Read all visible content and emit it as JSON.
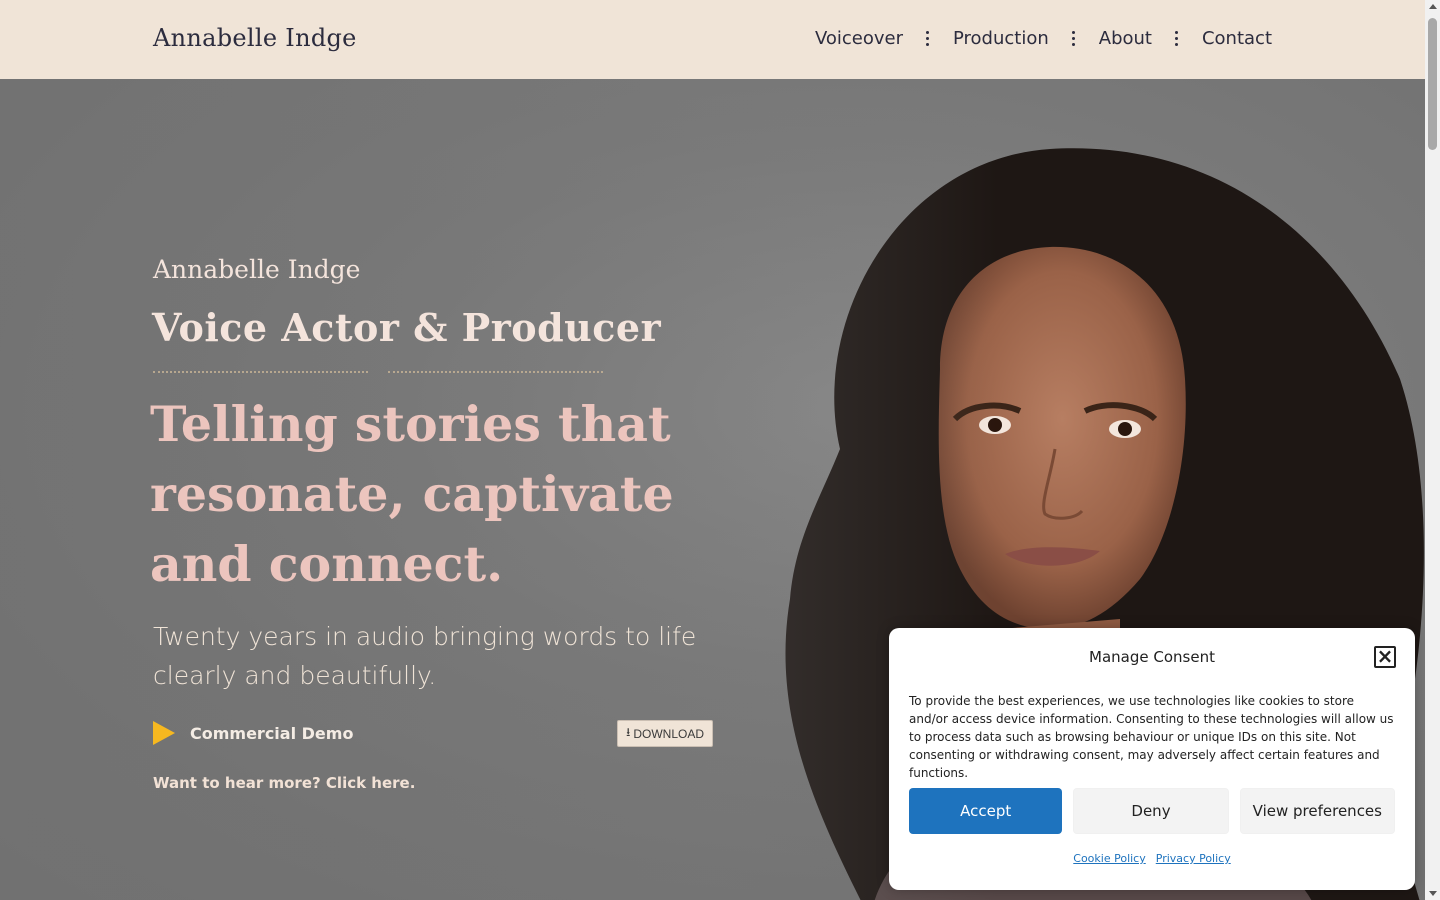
{
  "header": {
    "logo": "Annabelle Indge",
    "nav": [
      {
        "label": "Voiceover"
      },
      {
        "label": "Production"
      },
      {
        "label": "About"
      },
      {
        "label": "Contact"
      }
    ]
  },
  "hero": {
    "name": "Annabelle Indge",
    "role": "Voice Actor & Producer",
    "tagline": "Telling stories that resonate, captivate and connect.",
    "subtitle": "Twenty years in audio bringing words to life clearly and beautifully.",
    "player": {
      "icon": "play-icon",
      "label": "Commercial Demo",
      "download_label": "DOWNLOAD",
      "download_icon": "download-icon"
    },
    "more_link": "Want to hear more? Click here."
  },
  "consent": {
    "title": "Manage Consent",
    "close_icon": "close-icon",
    "body": "To provide the best experiences, we use technologies like cookies to store and/or access device information. Consenting to these technologies will allow us to process data such as browsing behaviour or unique IDs on this site. Not consenting or withdrawing consent, may adversely affect certain features and functions.",
    "accept_label": "Accept",
    "deny_label": "Deny",
    "preferences_label": "View preferences",
    "cookie_policy_label": "Cookie Policy",
    "privacy_policy_label": "Privacy Policy"
  },
  "colors": {
    "header_bg": "#f0e4d7",
    "accent": "#1e73be",
    "play": "#f6b820",
    "tagline": "#ecc5be"
  }
}
